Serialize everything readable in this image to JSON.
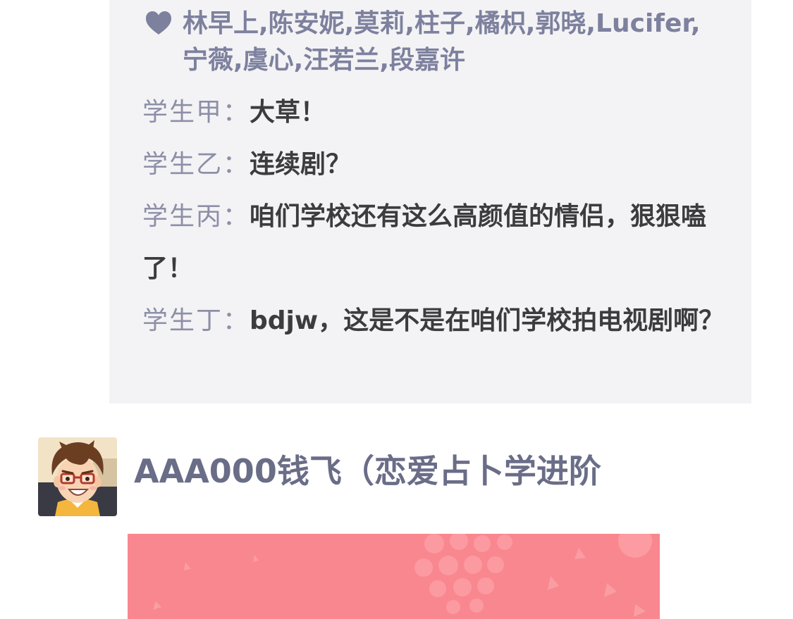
{
  "post": {
    "likes": "林早上,陈安妮,莫莉,柱子,橘枳,郭晓,Lucifer,宁薇,虞心,汪若兰,段嘉许",
    "comments": [
      {
        "speaker": "学生甲：",
        "text": "大草！"
      },
      {
        "speaker": "学生乙：",
        "text": "连续剧？"
      },
      {
        "speaker": "学生丙：",
        "text": "咱们学校还有这么高颜值的情侣，狠狠嗑了！"
      },
      {
        "speaker": "学生丁：",
        "text": "bdjw，这是不是在咱们学校拍电视剧啊？"
      }
    ]
  },
  "next_post": {
    "username": "AAA000钱飞（恋爱占卜学进阶",
    "avatar_icon": "cartoon-boy-avatar"
  },
  "colors": {
    "card_bg": "#f3f3f5",
    "likes": "#7d819e",
    "speaker": "#8d8fa8",
    "comment_text": "#3c3c3f",
    "username": "#6a6d87",
    "banner": "#f9878f"
  }
}
